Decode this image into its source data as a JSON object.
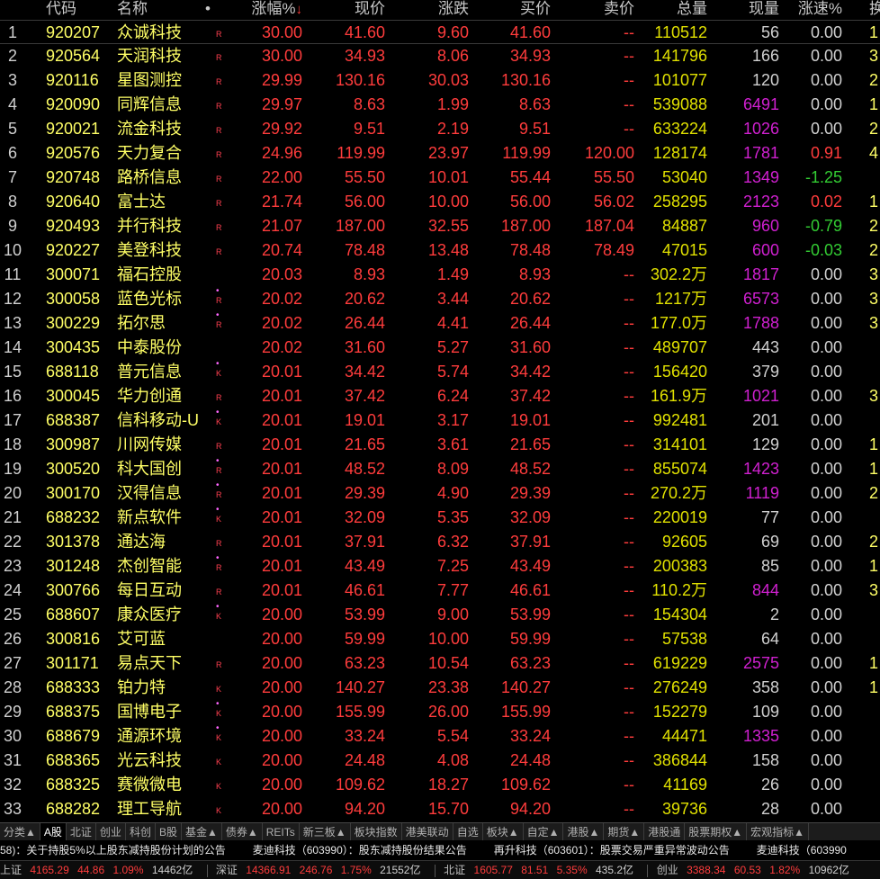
{
  "header": {
    "code": "代码",
    "name": "名称",
    "dot": "•",
    "pct": "涨幅%",
    "sort_arrow": "↓",
    "price": "现价",
    "chg": "涨跌",
    "bid": "买价",
    "ask": "卖价",
    "vol": "总量",
    "cur": "现量",
    "spd": "涨速%",
    "ext": "换"
  },
  "rows": [
    {
      "idx": "1",
      "code": "920207",
      "name": "众诚科技",
      "flag_dot": "",
      "flag": "R",
      "pct": "30.00",
      "price": "41.60",
      "chg": "9.60",
      "bid": "41.60",
      "ask": "--",
      "vol": "110512",
      "cur": "56",
      "cur_color": "white",
      "spd": "0.00",
      "spd_color": "white",
      "ext": "1"
    },
    {
      "idx": "2",
      "code": "920564",
      "name": "天润科技",
      "flag_dot": "",
      "flag": "R",
      "pct": "30.00",
      "price": "34.93",
      "chg": "8.06",
      "bid": "34.93",
      "ask": "--",
      "vol": "141796",
      "cur": "166",
      "cur_color": "white",
      "spd": "0.00",
      "spd_color": "white",
      "ext": "3"
    },
    {
      "idx": "3",
      "code": "920116",
      "name": "星图测控",
      "flag_dot": "",
      "flag": "R",
      "pct": "29.99",
      "price": "130.16",
      "chg": "30.03",
      "bid": "130.16",
      "ask": "--",
      "vol": "101077",
      "cur": "120",
      "cur_color": "white",
      "spd": "0.00",
      "spd_color": "white",
      "ext": "2"
    },
    {
      "idx": "4",
      "code": "920090",
      "name": "同辉信息",
      "flag_dot": "",
      "flag": "R",
      "pct": "29.97",
      "price": "8.63",
      "chg": "1.99",
      "bid": "8.63",
      "ask": "--",
      "vol": "539088",
      "cur": "6491",
      "cur_color": "mag",
      "spd": "0.00",
      "spd_color": "white",
      "ext": "1"
    },
    {
      "idx": "5",
      "code": "920021",
      "name": "流金科技",
      "flag_dot": "",
      "flag": "R",
      "pct": "29.92",
      "price": "9.51",
      "chg": "2.19",
      "bid": "9.51",
      "ask": "--",
      "vol": "633224",
      "cur": "1026",
      "cur_color": "mag",
      "spd": "0.00",
      "spd_color": "white",
      "ext": "2"
    },
    {
      "idx": "6",
      "code": "920576",
      "name": "天力复合",
      "flag_dot": "",
      "flag": "R",
      "pct": "24.96",
      "price": "119.99",
      "chg": "23.97",
      "bid": "119.99",
      "ask": "120.00",
      "vol": "128174",
      "cur": "1781",
      "cur_color": "mag",
      "spd": "0.91",
      "spd_color": "up",
      "ext": "4"
    },
    {
      "idx": "7",
      "code": "920748",
      "name": "路桥信息",
      "flag_dot": "",
      "flag": "R",
      "pct": "22.00",
      "price": "55.50",
      "chg": "10.01",
      "bid": "55.44",
      "ask": "55.50",
      "vol": "53040",
      "cur": "1349",
      "cur_color": "mag",
      "spd": "-1.25",
      "spd_color": "dn",
      "ext": ""
    },
    {
      "idx": "8",
      "code": "920640",
      "name": "富士达",
      "flag_dot": "",
      "flag": "R",
      "pct": "21.74",
      "price": "56.00",
      "chg": "10.00",
      "bid": "56.00",
      "ask": "56.02",
      "vol": "258295",
      "cur": "2123",
      "cur_color": "mag",
      "spd": "0.02",
      "spd_color": "up",
      "ext": "1"
    },
    {
      "idx": "9",
      "code": "920493",
      "name": "并行科技",
      "flag_dot": "",
      "flag": "R",
      "pct": "21.07",
      "price": "187.00",
      "chg": "32.55",
      "bid": "187.00",
      "ask": "187.04",
      "vol": "84887",
      "cur": "960",
      "cur_color": "mag",
      "spd": "-0.79",
      "spd_color": "dn",
      "ext": "2"
    },
    {
      "idx": "10",
      "code": "920227",
      "name": "美登科技",
      "flag_dot": "",
      "flag": "R",
      "pct": "20.74",
      "price": "78.48",
      "chg": "13.48",
      "bid": "78.48",
      "ask": "78.49",
      "vol": "47015",
      "cur": "600",
      "cur_color": "mag",
      "spd": "-0.03",
      "spd_color": "dn",
      "ext": "2"
    },
    {
      "idx": "11",
      "code": "300071",
      "name": "福石控股",
      "flag_dot": "",
      "flag": "",
      "pct": "20.03",
      "price": "8.93",
      "chg": "1.49",
      "bid": "8.93",
      "ask": "--",
      "vol": "302.2万",
      "cur": "1817",
      "cur_color": "mag",
      "spd": "0.00",
      "spd_color": "white",
      "ext": "3"
    },
    {
      "idx": "12",
      "code": "300058",
      "name": "蓝色光标",
      "flag_dot": "•",
      "flag": "R",
      "pct": "20.02",
      "price": "20.62",
      "chg": "3.44",
      "bid": "20.62",
      "ask": "--",
      "vol": "1217万",
      "cur": "6573",
      "cur_color": "mag",
      "spd": "0.00",
      "spd_color": "white",
      "ext": "3"
    },
    {
      "idx": "13",
      "code": "300229",
      "name": "拓尔思",
      "flag_dot": "•",
      "flag": "R",
      "pct": "20.02",
      "price": "26.44",
      "chg": "4.41",
      "bid": "26.44",
      "ask": "--",
      "vol": "177.0万",
      "cur": "1788",
      "cur_color": "mag",
      "spd": "0.00",
      "spd_color": "white",
      "ext": "3"
    },
    {
      "idx": "14",
      "code": "300435",
      "name": "中泰股份",
      "flag_dot": "",
      "flag": "",
      "pct": "20.02",
      "price": "31.60",
      "chg": "5.27",
      "bid": "31.60",
      "ask": "--",
      "vol": "489707",
      "cur": "443",
      "cur_color": "white",
      "spd": "0.00",
      "spd_color": "white",
      "ext": ""
    },
    {
      "idx": "15",
      "code": "688118",
      "name": "普元信息",
      "flag_dot": "•",
      "flag": "K",
      "pct": "20.01",
      "price": "34.42",
      "chg": "5.74",
      "bid": "34.42",
      "ask": "--",
      "vol": "156420",
      "cur": "379",
      "cur_color": "white",
      "spd": "0.00",
      "spd_color": "white",
      "ext": ""
    },
    {
      "idx": "16",
      "code": "300045",
      "name": "华力创通",
      "flag_dot": "",
      "flag": "R",
      "pct": "20.01",
      "price": "37.42",
      "chg": "6.24",
      "bid": "37.42",
      "ask": "--",
      "vol": "161.9万",
      "cur": "1021",
      "cur_color": "mag",
      "spd": "0.00",
      "spd_color": "white",
      "ext": "3"
    },
    {
      "idx": "17",
      "code": "688387",
      "name": "信科移动-U",
      "flag_dot": "•",
      "flag": "K",
      "pct": "20.01",
      "price": "19.01",
      "chg": "3.17",
      "bid": "19.01",
      "ask": "--",
      "vol": "992481",
      "cur": "201",
      "cur_color": "white",
      "spd": "0.00",
      "spd_color": "white",
      "ext": ""
    },
    {
      "idx": "18",
      "code": "300987",
      "name": "川网传媒",
      "flag_dot": "",
      "flag": "R",
      "pct": "20.01",
      "price": "21.65",
      "chg": "3.61",
      "bid": "21.65",
      "ask": "--",
      "vol": "314101",
      "cur": "129",
      "cur_color": "white",
      "spd": "0.00",
      "spd_color": "white",
      "ext": "1"
    },
    {
      "idx": "19",
      "code": "300520",
      "name": "科大国创",
      "flag_dot": "•",
      "flag": "R",
      "pct": "20.01",
      "price": "48.52",
      "chg": "8.09",
      "bid": "48.52",
      "ask": "--",
      "vol": "855074",
      "cur": "1423",
      "cur_color": "mag",
      "spd": "0.00",
      "spd_color": "white",
      "ext": "1"
    },
    {
      "idx": "20",
      "code": "300170",
      "name": "汉得信息",
      "flag_dot": "•",
      "flag": "R",
      "pct": "20.01",
      "price": "29.39",
      "chg": "4.90",
      "bid": "29.39",
      "ask": "--",
      "vol": "270.2万",
      "cur": "1119",
      "cur_color": "mag",
      "spd": "0.00",
      "spd_color": "white",
      "ext": "2"
    },
    {
      "idx": "21",
      "code": "688232",
      "name": "新点软件",
      "flag_dot": "•",
      "flag": "K",
      "pct": "20.01",
      "price": "32.09",
      "chg": "5.35",
      "bid": "32.09",
      "ask": "--",
      "vol": "220019",
      "cur": "77",
      "cur_color": "white",
      "spd": "0.00",
      "spd_color": "white",
      "ext": ""
    },
    {
      "idx": "22",
      "code": "301378",
      "name": "通达海",
      "flag_dot": "",
      "flag": "R",
      "pct": "20.01",
      "price": "37.91",
      "chg": "6.32",
      "bid": "37.91",
      "ask": "--",
      "vol": "92605",
      "cur": "69",
      "cur_color": "white",
      "spd": "0.00",
      "spd_color": "white",
      "ext": "2"
    },
    {
      "idx": "23",
      "code": "301248",
      "name": "杰创智能",
      "flag_dot": "•",
      "flag": "R",
      "pct": "20.01",
      "price": "43.49",
      "chg": "7.25",
      "bid": "43.49",
      "ask": "--",
      "vol": "200383",
      "cur": "85",
      "cur_color": "white",
      "spd": "0.00",
      "spd_color": "white",
      "ext": "1"
    },
    {
      "idx": "24",
      "code": "300766",
      "name": "每日互动",
      "flag_dot": "",
      "flag": "R",
      "pct": "20.01",
      "price": "46.61",
      "chg": "7.77",
      "bid": "46.61",
      "ask": "--",
      "vol": "110.2万",
      "cur": "844",
      "cur_color": "mag",
      "spd": "0.00",
      "spd_color": "white",
      "ext": "3"
    },
    {
      "idx": "25",
      "code": "688607",
      "name": "康众医疗",
      "flag_dot": "•",
      "flag": "K",
      "pct": "20.00",
      "price": "53.99",
      "chg": "9.00",
      "bid": "53.99",
      "ask": "--",
      "vol": "154304",
      "cur": "2",
      "cur_color": "white",
      "spd": "0.00",
      "spd_color": "white",
      "ext": ""
    },
    {
      "idx": "26",
      "code": "300816",
      "name": "艾可蓝",
      "flag_dot": "",
      "flag": "",
      "pct": "20.00",
      "price": "59.99",
      "chg": "10.00",
      "bid": "59.99",
      "ask": "--",
      "vol": "57538",
      "cur": "64",
      "cur_color": "white",
      "spd": "0.00",
      "spd_color": "white",
      "ext": ""
    },
    {
      "idx": "27",
      "code": "301171",
      "name": "易点天下",
      "flag_dot": "",
      "flag": "R",
      "pct": "20.00",
      "price": "63.23",
      "chg": "10.54",
      "bid": "63.23",
      "ask": "--",
      "vol": "619229",
      "cur": "2575",
      "cur_color": "mag",
      "spd": "0.00",
      "spd_color": "white",
      "ext": "1"
    },
    {
      "idx": "28",
      "code": "688333",
      "name": "铂力特",
      "flag_dot": "",
      "flag": "K",
      "pct": "20.00",
      "price": "140.27",
      "chg": "23.38",
      "bid": "140.27",
      "ask": "--",
      "vol": "276249",
      "cur": "358",
      "cur_color": "white",
      "spd": "0.00",
      "spd_color": "white",
      "ext": "1"
    },
    {
      "idx": "29",
      "code": "688375",
      "name": "国博电子",
      "flag_dot": "•",
      "flag": "K",
      "pct": "20.00",
      "price": "155.99",
      "chg": "26.00",
      "bid": "155.99",
      "ask": "--",
      "vol": "152279",
      "cur": "109",
      "cur_color": "white",
      "spd": "0.00",
      "spd_color": "white",
      "ext": ""
    },
    {
      "idx": "30",
      "code": "688679",
      "name": "通源环境",
      "flag_dot": "•",
      "flag": "K",
      "pct": "20.00",
      "price": "33.24",
      "chg": "5.54",
      "bid": "33.24",
      "ask": "--",
      "vol": "44471",
      "cur": "1335",
      "cur_color": "mag",
      "spd": "0.00",
      "spd_color": "white",
      "ext": ""
    },
    {
      "idx": "31",
      "code": "688365",
      "name": "光云科技",
      "flag_dot": "",
      "flag": "K",
      "pct": "20.00",
      "price": "24.48",
      "chg": "4.08",
      "bid": "24.48",
      "ask": "--",
      "vol": "386844",
      "cur": "158",
      "cur_color": "white",
      "spd": "0.00",
      "spd_color": "white",
      "ext": ""
    },
    {
      "idx": "32",
      "code": "688325",
      "name": "赛微微电",
      "flag_dot": "",
      "flag": "K",
      "pct": "20.00",
      "price": "109.62",
      "chg": "18.27",
      "bid": "109.62",
      "ask": "--",
      "vol": "41169",
      "cur": "26",
      "cur_color": "white",
      "spd": "0.00",
      "spd_color": "white",
      "ext": ""
    },
    {
      "idx": "33",
      "code": "688282",
      "name": "理工导航",
      "flag_dot": "",
      "flag": "K",
      "pct": "20.00",
      "price": "94.20",
      "chg": "15.70",
      "bid": "94.20",
      "ask": "--",
      "vol": "39736",
      "cur": "28",
      "cur_color": "white",
      "spd": "0.00",
      "spd_color": "white",
      "ext": ""
    }
  ],
  "tabs": [
    "分类▲",
    "A股",
    "北证",
    "创业",
    "科创",
    "B股",
    "基金▲",
    "债券▲",
    "REITs",
    "新三板▲",
    "板块指数",
    "港美联动",
    "自选",
    "板块▲",
    "自定▲",
    "港股▲",
    "期货▲",
    "港股通",
    "股票期权▲",
    "宏观指标▲"
  ],
  "active_tab": "A股",
  "news": [
    "58)：关于持股5%以上股东减持股份计划的公告",
    "麦迪科技（603990）：股东减持股份结果公告",
    "再升科技（603601）：股票交易严重异常波动公告",
    "麦迪科技（603990"
  ],
  "status": {
    "sh_label": "上证",
    "sh_val": "4165.29",
    "sh_chg": "44.86",
    "sh_pct": "1.09%",
    "sh_amt": "14462亿",
    "sz_label": "深证",
    "sz_val": "14366.91",
    "sz_chg": "246.76",
    "sz_pct": "1.75%",
    "sz_amt": "21552亿",
    "bz_label": "北证",
    "bz_val": "1605.77",
    "bz_chg": "81.51",
    "bz_pct": "5.35%",
    "bz_amt": "435.2亿",
    "cy_label": "创业",
    "cy_val": "3388.34",
    "cy_chg": "60.53",
    "cy_pct": "1.82%",
    "cy_amt": "10962亿"
  },
  "colors": {
    "up": "#ff3c3c",
    "down": "#33cc33",
    "code": "#ffff66",
    "volume": "#e0e000",
    "current_vol_big": "#d020d0",
    "flag": "#ff4050"
  }
}
